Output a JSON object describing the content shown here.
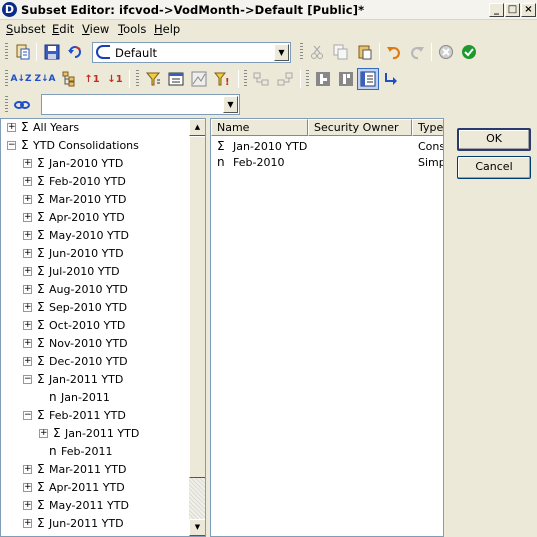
{
  "window": {
    "title": "Subset Editor:  ifcvod->VodMonth->Default  [Public]*",
    "minimize_glyph": "_",
    "maximize_glyph": "□",
    "close_glyph": "×"
  },
  "menu": [
    "Subset",
    "Edit",
    "View",
    "Tools",
    "Help"
  ],
  "menu_mnemonics": [
    "S",
    "E",
    "V",
    "T",
    "H"
  ],
  "toolbar": {
    "subset_combo_value": "Default",
    "filter_combo_value": "",
    "icons_row1": [
      "paste-subset-icon",
      "save-icon",
      "refresh-icon",
      "cut-icon",
      "copy-icon",
      "paste-icon",
      "undo-icon",
      "redo-icon",
      "cancel-icon",
      "ok-icon"
    ],
    "icons_row2": [
      "sort-az-icon",
      "sort-za-icon",
      "sort-hierarchy-icon",
      "sort-asc-icon",
      "sort-desc-icon",
      "filter-level-icon",
      "filter-attribute-icon",
      "filter-chart-icon",
      "filter-expression-icon",
      "expand-icon",
      "collapse-icon",
      "keep-icon",
      "delete-icon",
      "properties-icon",
      "insert-parents-icon"
    ],
    "icons_row3": [
      "link-icon"
    ]
  },
  "tree": {
    "items": [
      {
        "label": "All Years",
        "symbol": "Σ",
        "toggle": "+",
        "level": 0
      },
      {
        "label": "YTD Consolidations",
        "symbol": "Σ",
        "toggle": "−",
        "level": 0
      },
      {
        "label": "Jan-2010 YTD",
        "symbol": "Σ",
        "toggle": "+",
        "level": 1
      },
      {
        "label": "Feb-2010 YTD",
        "symbol": "Σ",
        "toggle": "+",
        "level": 1
      },
      {
        "label": "Mar-2010 YTD",
        "symbol": "Σ",
        "toggle": "+",
        "level": 1
      },
      {
        "label": "Apr-2010 YTD",
        "symbol": "Σ",
        "toggle": "+",
        "level": 1
      },
      {
        "label": "May-2010 YTD",
        "symbol": "Σ",
        "toggle": "+",
        "level": 1
      },
      {
        "label": "Jun-2010 YTD",
        "symbol": "Σ",
        "toggle": "+",
        "level": 1
      },
      {
        "label": "Jul-2010 YTD",
        "symbol": "Σ",
        "toggle": "+",
        "level": 1
      },
      {
        "label": "Aug-2010 YTD",
        "symbol": "Σ",
        "toggle": "+",
        "level": 1
      },
      {
        "label": "Sep-2010 YTD",
        "symbol": "Σ",
        "toggle": "+",
        "level": 1
      },
      {
        "label": "Oct-2010 YTD",
        "symbol": "Σ",
        "toggle": "+",
        "level": 1
      },
      {
        "label": "Nov-2010 YTD",
        "symbol": "Σ",
        "toggle": "+",
        "level": 1
      },
      {
        "label": "Dec-2010 YTD",
        "symbol": "Σ",
        "toggle": "+",
        "level": 1
      },
      {
        "label": "Jan-2011 YTD",
        "symbol": "Σ",
        "toggle": "−",
        "level": 1
      },
      {
        "label": "Jan-2011",
        "symbol": "n",
        "toggle": "",
        "level": 2
      },
      {
        "label": "Feb-2011 YTD",
        "symbol": "Σ",
        "toggle": "−",
        "level": 1
      },
      {
        "label": "Jan-2011 YTD",
        "symbol": "Σ",
        "toggle": "+",
        "level": 2
      },
      {
        "label": "Feb-2011",
        "symbol": "n",
        "toggle": "",
        "level": 2
      },
      {
        "label": "Mar-2011 YTD",
        "symbol": "Σ",
        "toggle": "+",
        "level": 1
      },
      {
        "label": "Apr-2011 YTD",
        "symbol": "Σ",
        "toggle": "+",
        "level": 1
      },
      {
        "label": "May-2011 YTD",
        "symbol": "Σ",
        "toggle": "+",
        "level": 1
      },
      {
        "label": "Jun-2011 YTD",
        "symbol": "Σ",
        "toggle": "+",
        "level": 1
      }
    ]
  },
  "list": {
    "columns": [
      "Name",
      "Security Owner",
      "Type"
    ],
    "rows": [
      {
        "symbol": "Σ",
        "name": "Jan-2010 YTD",
        "type": "Conso"
      },
      {
        "symbol": "n",
        "name": "Feb-2010",
        "type": "Simple"
      }
    ]
  },
  "buttons": {
    "ok": "OK",
    "cancel": "Cancel"
  },
  "colors": {
    "accent": "#316ac5",
    "ok_green": "#1c9a2c",
    "cancel_gray": "#8a8a8a",
    "undo_orange": "#e07a10"
  }
}
